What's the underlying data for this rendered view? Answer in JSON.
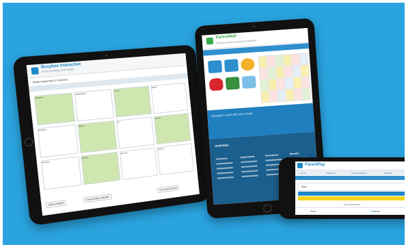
{
  "tablet_left": {
    "app_title": "Busybee Interactive",
    "app_subtitle": "Parent bookings made simple",
    "week_label": "Week beginning 12 January",
    "schedule_cells": [
      "Alphabet",
      "Registration",
      "Lunch",
      "Maths",
      "Reading",
      "Music",
      "Art",
      "Games",
      "Phonics",
      "History",
      "Science",
      "Drama"
    ],
    "footer_left_button": "Add to basket",
    "footer_mid_button": "View weekly calendar",
    "footer_right_button": "Go to my account"
  },
  "tablet_right": {
    "app_title": "ParentMail",
    "app_subtitle": "Bringing schools and parents together",
    "nav_items": [
      "Home",
      "Messages",
      "Payments",
      "Forms",
      "Calendar",
      "Settings"
    ],
    "banner_text": "Keeping in touch with your school",
    "info_title": "Activities",
    "info_columns": [
      "Outcomes",
      "Expressions",
      "Innovations",
      "Benefits"
    ]
  },
  "phone": {
    "app_title": "ParentPay",
    "tabs": [
      "Home",
      "Payments",
      "Communications",
      "Settings"
    ],
    "item_title": "Trips",
    "pay_bar_label": "Pay this balance",
    "secondary_bar_label": "Go to my account",
    "footer_left": "Back",
    "footer_right": "Continue"
  },
  "colors": {
    "background": "#2aa3df",
    "brand_blue": "#1e88c9",
    "green": "#3aa94a",
    "yellow": "#f4d41c"
  }
}
